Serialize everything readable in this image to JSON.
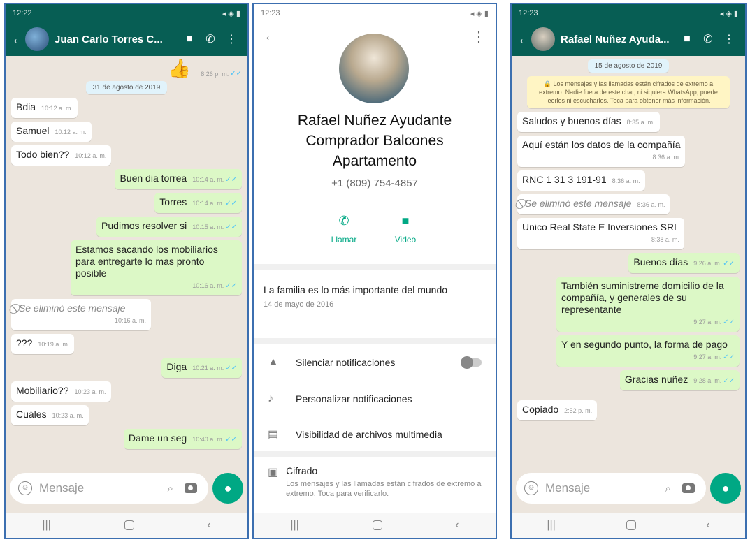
{
  "screen1": {
    "status_time": "12:22",
    "status_right": "◂ ◈ ▮",
    "contact": "Juan Carlo Torres C...",
    "messages": [
      {
        "dir": "out",
        "text": "👍",
        "time": "8:26 p. m."
      },
      {
        "dir": "date",
        "text": "31 de agosto de 2019"
      },
      {
        "dir": "in",
        "text": "Bdia",
        "time": "10:12 a. m."
      },
      {
        "dir": "in",
        "text": "Samuel",
        "time": "10:12 a. m."
      },
      {
        "dir": "in",
        "text": "Todo bien??",
        "time": "10:12 a. m."
      },
      {
        "dir": "out",
        "text": "Buen dia torrea",
        "time": "10:14 a. m."
      },
      {
        "dir": "out",
        "text": "Torres",
        "time": "10:14 a. m."
      },
      {
        "dir": "out",
        "text": "Pudimos resolver si",
        "time": "10:15 a. m."
      },
      {
        "dir": "out",
        "text": "Estamos sacando los mobiliarios para entregarte lo mas pronto posible",
        "time": "10:16 a. m."
      },
      {
        "dir": "in",
        "text": "Se eliminó este mensaje",
        "time": "10:16 a. m."
      },
      {
        "dir": "in",
        "text": "???",
        "time": "10:19 a. m."
      },
      {
        "dir": "out",
        "text": "Diga",
        "time": "10:21 a. m."
      },
      {
        "dir": "in",
        "text": "Mobiliario??",
        "time": "10:23 a. m."
      },
      {
        "dir": "in",
        "text": "Cuáles",
        "time": "10:23 a. m."
      },
      {
        "dir": "out",
        "text": "Dame un seg",
        "time": "10:40 a. m."
      }
    ],
    "placeholder": "Mensaje"
  },
  "screen2": {
    "status_time": "12:23",
    "status_right": "◂ ◈ ▮",
    "name": "Rafael Nuñez Ayudante Comprador Balcones Apartamento",
    "phone": "+1 (809) 754-4857",
    "call_label": "Llamar",
    "video_label": "Video",
    "about": "La familia es lo más importante del mundo",
    "about_date": "14 de mayo de 2016",
    "mute_label": "Silenciar notificaciones",
    "custom_label": "Personalizar notificaciones",
    "media_label": "Visibilidad de archivos multimedia",
    "enc_title": "Cifrado",
    "enc_desc": "Los mensajes y las llamadas están cifrados de extremo a extremo. Toca para verificarlo."
  },
  "screen3": {
    "status_time": "12:23",
    "status_right": "◂ ◈ ▮",
    "contact": "Rafael Nuñez Ayuda...",
    "date": "15 de agosto de 2019",
    "encryption_notice": "🔒 Los mensajes y las llamadas están cifrados de extremo a extremo. Nadie fuera de este chat, ni siquiera WhatsApp, puede leerlos ni escucharlos. Toca para obtener más información.",
    "messages": [
      {
        "dir": "in",
        "text": "Saludos y buenos días",
        "time": "8:35 a. m."
      },
      {
        "dir": "in",
        "text": "Aquí están los datos de la compañía",
        "time": "8:36 a. m."
      },
      {
        "dir": "in",
        "text": "RNC 1 31 3 191-91",
        "time": "8:36 a. m."
      },
      {
        "dir": "in",
        "text": "Se eliminó este mensaje",
        "time": "8:36 a. m."
      },
      {
        "dir": "in",
        "text": "Unico Real State E Inversiones SRL",
        "time": "8:38 a. m."
      },
      {
        "dir": "out",
        "text": "Buenos días",
        "time": "9:26 a. m."
      },
      {
        "dir": "out",
        "text": "También suministreme domicilio de la compañía, y generales de su representante",
        "time": "9:27 a. m."
      },
      {
        "dir": "out",
        "text": "Y en segundo punto, la forma de pago",
        "time": "9:27 a. m."
      },
      {
        "dir": "out",
        "text": "Gracias nuñez",
        "time": "9:28 a. m."
      },
      {
        "dir": "in",
        "text": "Copiado",
        "time": "2:52 p. m."
      }
    ],
    "placeholder": "Mensaje"
  }
}
